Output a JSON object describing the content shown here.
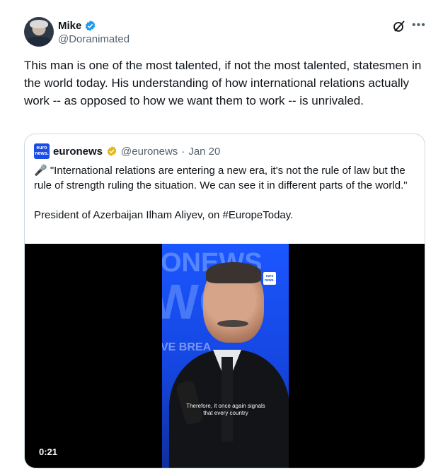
{
  "author": {
    "display_name": "Mike",
    "handle": "@Doranimated",
    "verified_color": "#1d9bf0"
  },
  "tweet": {
    "text": "This man is one of the most talented, if not the most talented, statesmen in the world today.  His understanding of how international relations actually work -- as opposed to how we want them to work -- is unrivaled."
  },
  "icons": {
    "grok": "grok-icon",
    "more": "more-icon"
  },
  "quoted": {
    "logo_text": "euro news.",
    "name": "euronews",
    "handle": "@euronews",
    "separator": "·",
    "date": "Jan 20",
    "badge_color": "#e2b719",
    "line1": "\"International relations are entering a new era, it's not the rule of law but the rule of strength ruling the situation. We can see it in different parts of the world.\"",
    "line1_emoji": "🎤",
    "line2": "President of Azerbaijan Ilham Aliyev, on #EuropeToday.",
    "video": {
      "bg_text_top": "ONEWS",
      "bg_text_mid": "WO",
      "bg_text_bottom": "VE BREA",
      "corner_badge": "euro news.",
      "subtitle": "Therefore, it once again signals that every country",
      "duration": "0:21"
    }
  }
}
